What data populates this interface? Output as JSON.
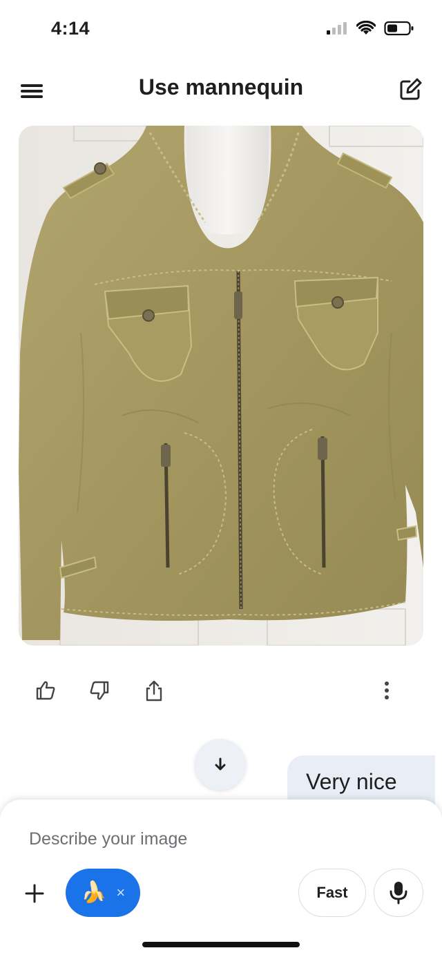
{
  "status_bar": {
    "time": "4:14"
  },
  "header": {
    "title": "Use mannequin"
  },
  "message": {
    "image_alt": "Olive green leather jacket on a mannequin"
  },
  "user_message": {
    "text": "Very nice"
  },
  "composer": {
    "placeholder": "Describe your image",
    "tool_chip_emoji": "🍌",
    "tool_chip_close": "×",
    "mode_label": "Fast"
  },
  "colors": {
    "accent": "#1a73e8",
    "bubble": "#e9eef6",
    "jacket": "#a59862"
  },
  "icons": [
    "menu-icon",
    "edit-icon",
    "thumbs-up-icon",
    "thumbs-down-icon",
    "share-icon",
    "more-vert-icon",
    "arrow-down-icon",
    "plus-icon",
    "close-icon",
    "mic-icon"
  ]
}
